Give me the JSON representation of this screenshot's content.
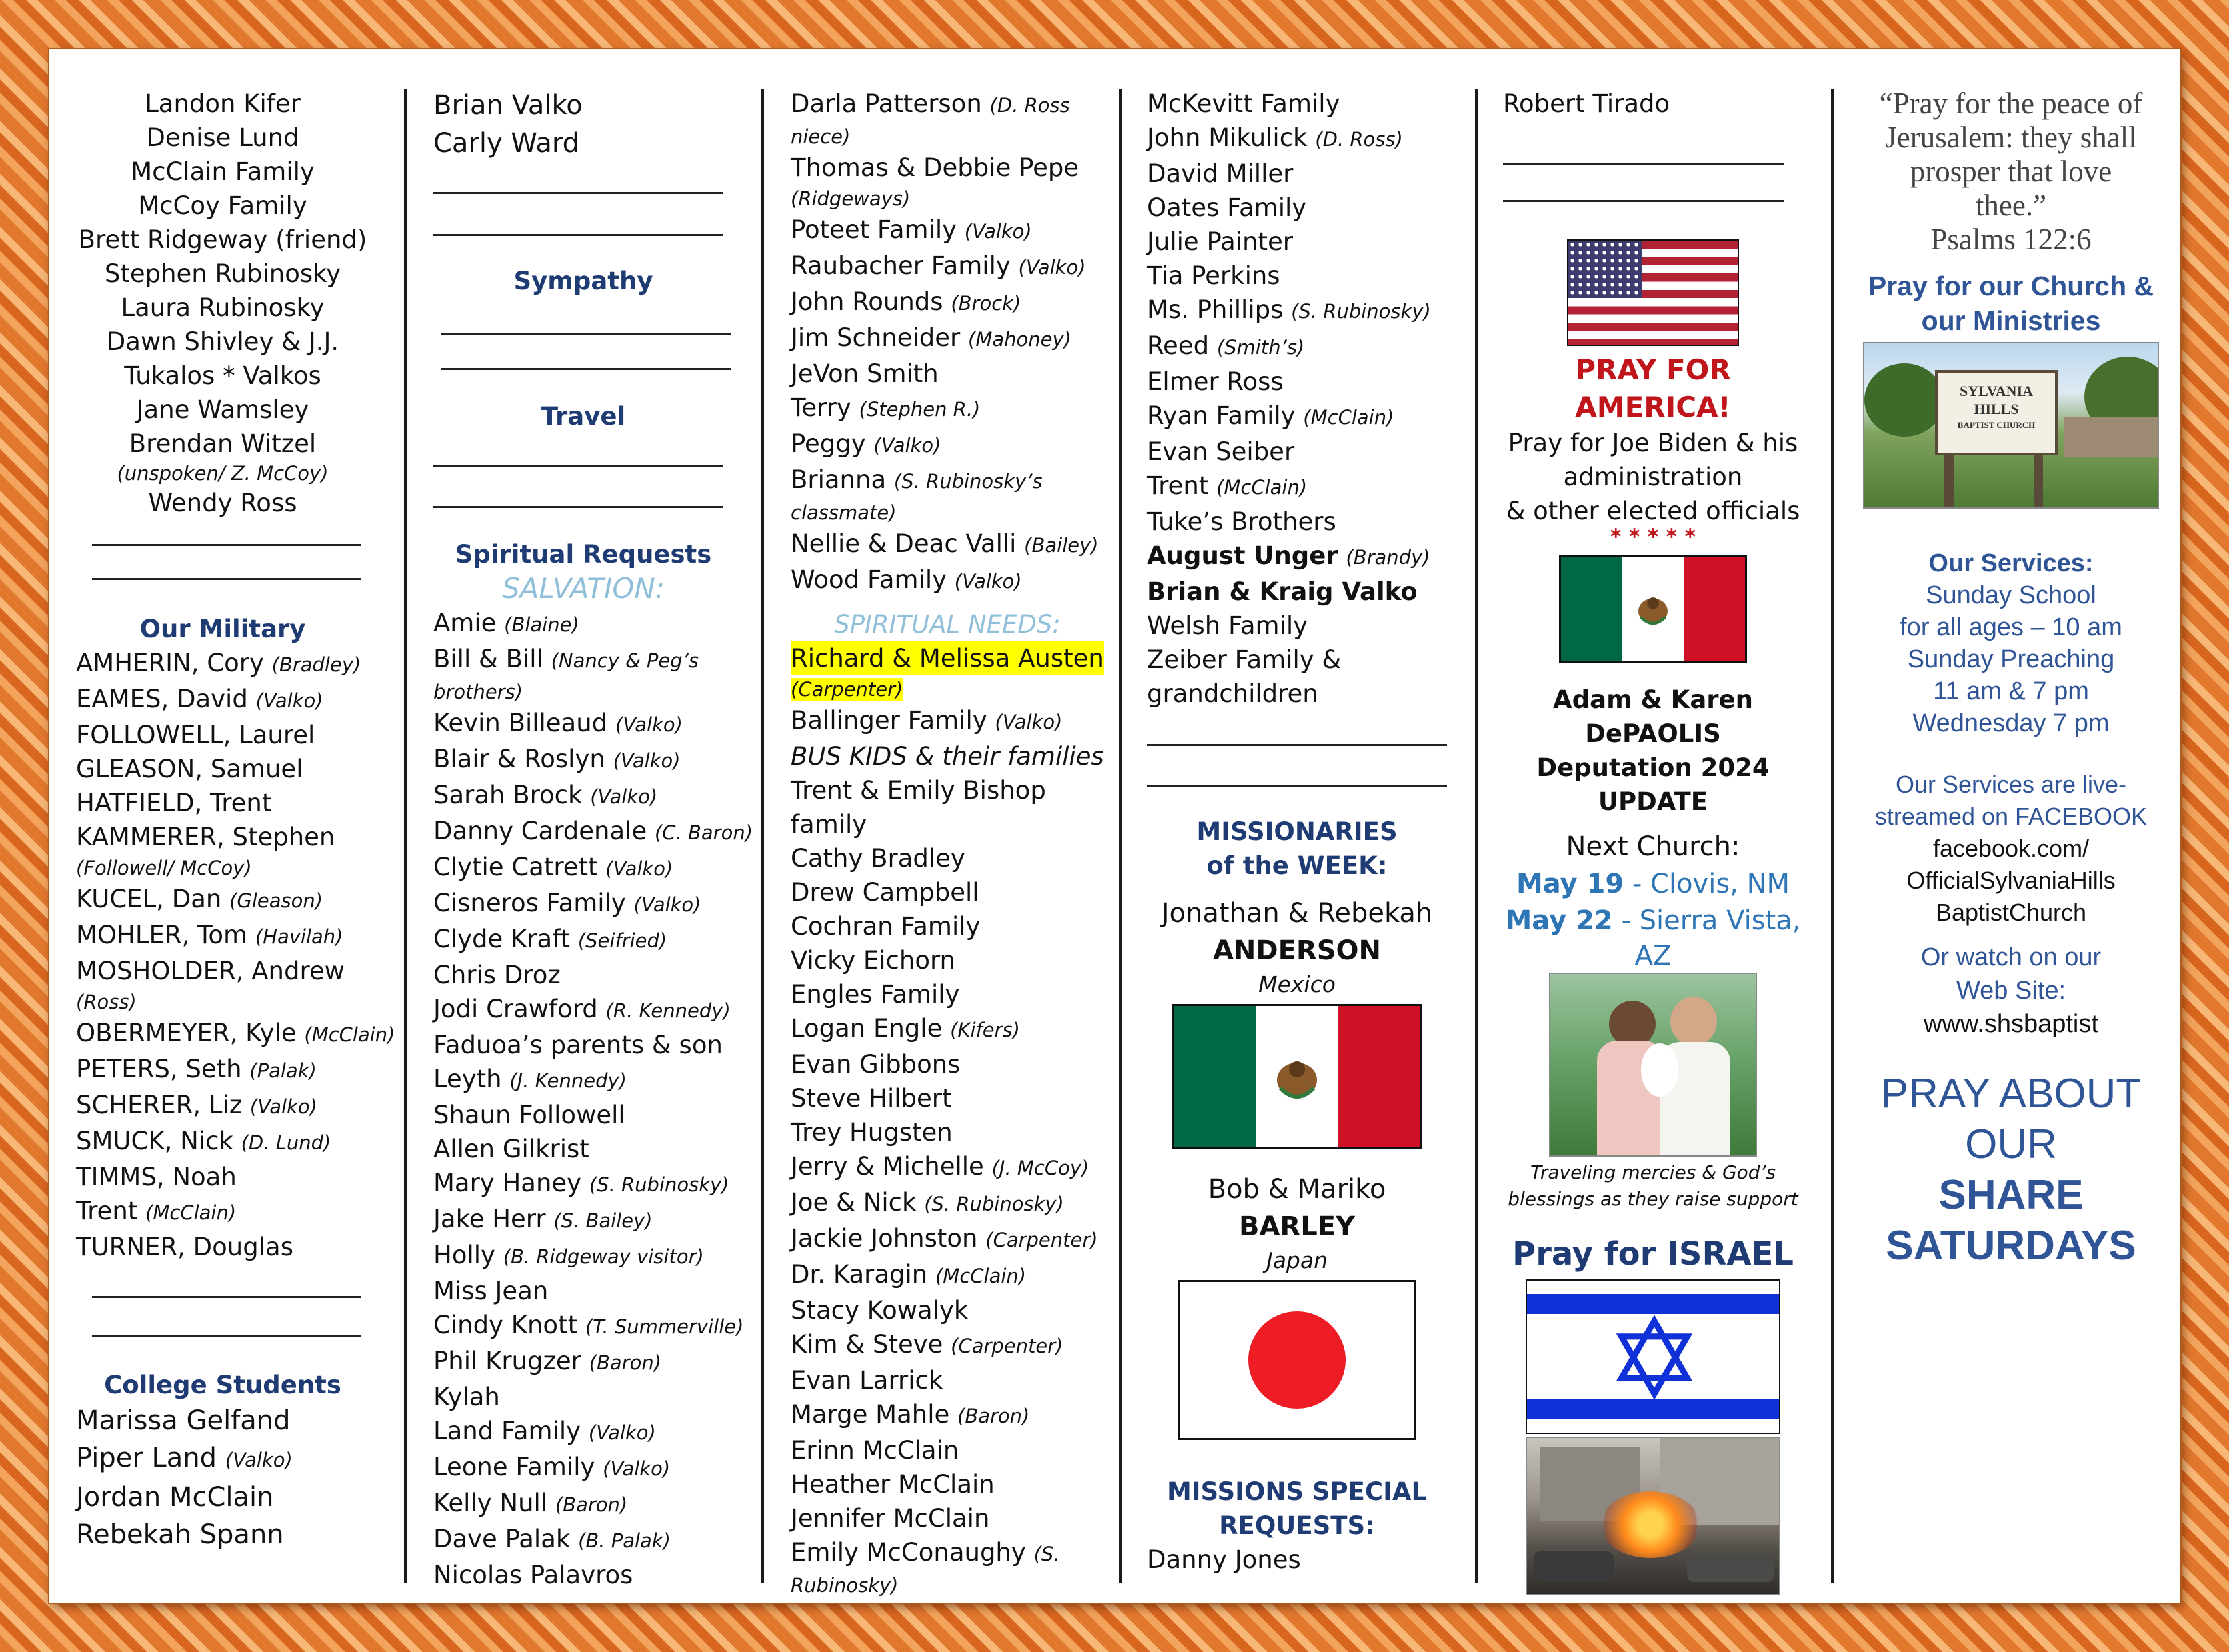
{
  "col1": {
    "names": [
      "Landon Kifer",
      "Denise Lund",
      "McClain Family",
      "McCoy Family",
      "Brett Ridgeway (friend)",
      "Stephen Rubinosky",
      "Laura Rubinosky",
      "Dawn Shivley & J.J.",
      "Tukalos * Valkos",
      "Jane Wamsley",
      "Brendan Witzel"
    ],
    "witzel_note": "(unspoken/ Z. McCoy)",
    "last": "Wendy Ross",
    "military_heading": "Our Military",
    "military": [
      {
        "name": "AMHERIN, Cory",
        "note": "(Bradley)"
      },
      {
        "name": "EAMES, David",
        "note": "(Valko)"
      },
      {
        "name": "FOLLOWELL, Laurel",
        "note": ""
      },
      {
        "name": "GLEASON, Samuel",
        "note": ""
      },
      {
        "name": "HATFIELD, Trent",
        "note": ""
      },
      {
        "name": "KAMMERER, Stephen",
        "note": ""
      }
    ],
    "kammerer_note": "(Followell/ McCoy)",
    "military2": [
      {
        "name": "KUCEL, Dan",
        "note": "(Gleason)"
      },
      {
        "name": "MOHLER, Tom",
        "note": "(Havilah)"
      },
      {
        "name": "MOSHOLDER, Andrew",
        "note": ""
      }
    ],
    "mosholder_note": "(Ross)",
    "military3": [
      {
        "name": "OBERMEYER, Kyle",
        "note": "(McClain)"
      },
      {
        "name": "PETERS, Seth",
        "note": "(Palak)"
      },
      {
        "name": "SCHERER, Liz",
        "note": "(Valko)"
      },
      {
        "name": "SMUCK, Nick",
        "note": "(D. Lund)"
      },
      {
        "name": "TIMMS, Noah",
        "note": ""
      },
      {
        "name": "Trent",
        "note": "(McClain)"
      },
      {
        "name": "TURNER, Douglas",
        "note": ""
      }
    ],
    "college_heading": "College Students",
    "college": [
      {
        "name": "Marissa Gelfand",
        "note": ""
      },
      {
        "name": "Piper Land",
        "note": "(Valko)"
      },
      {
        "name": "Jordan McClain",
        "note": ""
      },
      {
        "name": "Rebekah Spann",
        "note": ""
      }
    ]
  },
  "col2": {
    "top": [
      "Brian Valko",
      "Carly Ward"
    ],
    "sympathy_heading": "Sympathy",
    "travel_heading": "Travel",
    "spiritual_heading": "Spiritual Requests",
    "salvation_heading": "SALVATION:",
    "list": [
      {
        "name": "Amie",
        "note": "(Blaine)"
      },
      {
        "name": "Bill & Bill",
        "note": "(Nancy & Peg’s"
      }
    ],
    "bill_note2": "brothers)",
    "list2": [
      {
        "name": "Kevin Billeaud",
        "note": "(Valko)"
      },
      {
        "name": "Blair & Roslyn",
        "note": "(Valko)"
      },
      {
        "name": "Sarah Brock",
        "note": "(Valko)"
      },
      {
        "name": "Danny Cardenale",
        "note": "(C. Baron)"
      },
      {
        "name": "Clytie Catrett",
        "note": "(Valko)"
      },
      {
        "name": "Cisneros Family",
        "note": "(Valko)"
      },
      {
        "name": "Clyde Kraft",
        "note": "(Seifried)"
      },
      {
        "name": "Chris Droz",
        "note": ""
      },
      {
        "name": "Jodi Crawford",
        "note": "(R. Kennedy)"
      },
      {
        "name": "Faduoa’s parents & son",
        "note": ""
      },
      {
        "name": "Leyth",
        "note": "(J. Kennedy)"
      },
      {
        "name": "Shaun Followell",
        "note": ""
      },
      {
        "name": "Allen Gilkrist",
        "note": ""
      },
      {
        "name": "Mary Haney",
        "note": "(S. Rubinosky)"
      },
      {
        "name": "Jake Herr",
        "note": "(S. Bailey)"
      },
      {
        "name": "Holly",
        "note": "(B. Ridgeway visitor)"
      },
      {
        "name": "Miss Jean",
        "note": ""
      },
      {
        "name": "Cindy Knott",
        "note": "(T. Summerville)"
      },
      {
        "name": "Phil Krugzer",
        "note": "(Baron)"
      },
      {
        "name": "Kylah",
        "note": ""
      },
      {
        "name": "Land Family",
        "note": "(Valko)"
      },
      {
        "name": "Leone Family",
        "note": "(Valko)"
      },
      {
        "name": "Kelly Null",
        "note": "(Baron)"
      },
      {
        "name": "Dave Palak",
        "note": "(B. Palak)"
      },
      {
        "name": "Nicolas Palavros",
        "note": ""
      }
    ]
  },
  "col3": {
    "patterson": {
      "name": "Darla Patterson",
      "note": "(D. Ross",
      "note2": "niece)"
    },
    "pepe": {
      "name": "Thomas & Debbie Pepe",
      "note2": "(Ridgeways)"
    },
    "list": [
      {
        "name": "Poteet Family",
        "note": "(Valko)"
      },
      {
        "name": "Raubacher Family",
        "note": "(Valko)"
      },
      {
        "name": "John Rounds",
        "note": "(Brock)"
      },
      {
        "name": "Jim Schneider",
        "note": "(Mahoney)"
      },
      {
        "name": "JeVon Smith",
        "note": ""
      },
      {
        "name": "Terry",
        "note": "(Stephen R.)"
      },
      {
        "name": "Peggy",
        "note": "(Valko)"
      }
    ],
    "brianna": {
      "name": "Brianna",
      "note": "(S. Rubinosky’s",
      "note2": "classmate)"
    },
    "list2": [
      {
        "name": "Nellie & Deac Valli",
        "note": "(Bailey)"
      },
      {
        "name": "Wood Family",
        "note": "(Valko)"
      }
    ],
    "spiritual_needs": "SPIRITUAL NEEDS:",
    "austen": {
      "name": "Richard & Melissa Austen",
      "note2": "(Carpenter)"
    },
    "ballinger": {
      "name": "Ballinger Family",
      "note": "(Valko)"
    },
    "bus": "BUS KIDS & their families",
    "list3": [
      "Trent & Emily Bishop",
      "family",
      "Cathy Bradley",
      "Drew Campbell",
      "Cochran Family",
      "Vicky Eichorn",
      "Engles Family"
    ],
    "list4": [
      {
        "name": "Logan Engle",
        "note": "(Kifers)"
      },
      {
        "name": "Evan Gibbons",
        "note": ""
      },
      {
        "name": "Steve Hilbert",
        "note": ""
      },
      {
        "name": "Trey Hugsten",
        "note": ""
      },
      {
        "name": "Jerry & Michelle",
        "note": "(J. McCoy)"
      },
      {
        "name": "Joe & Nick",
        "note": "(S. Rubinosky)"
      },
      {
        "name": "Jackie Johnston",
        "note": "(Carpenter)"
      },
      {
        "name": "Dr. Karagin",
        "note": "(McClain)"
      },
      {
        "name": "Stacy Kowalyk",
        "note": ""
      },
      {
        "name": "Kim & Steve",
        "note": "(Carpenter)"
      },
      {
        "name": "Evan Larrick",
        "note": ""
      },
      {
        "name": "Marge Mahle",
        "note": "(Baron)"
      },
      {
        "name": "Erinn McClain",
        "note": ""
      },
      {
        "name": "Heather McClain",
        "note": ""
      },
      {
        "name": "Jennifer McClain",
        "note": ""
      }
    ],
    "mcconaughy": {
      "name": "Emily McConaughy",
      "note": "(S.",
      "note2": "Rubinosky)"
    }
  },
  "col4": {
    "list": [
      {
        "name": "McKevitt Family",
        "note": "",
        "bold": false
      },
      {
        "name": "John Mikulick",
        "note": "(D. Ross)",
        "bold": false
      },
      {
        "name": "David Miller",
        "note": "",
        "bold": false
      },
      {
        "name": "Oates Family",
        "note": "",
        "bold": false
      },
      {
        "name": "Julie Painter",
        "note": "",
        "bold": false
      },
      {
        "name": "Tia Perkins",
        "note": "",
        "bold": false
      },
      {
        "name": "Ms. Phillips",
        "note": "(S. Rubinosky)",
        "bold": false
      },
      {
        "name": "Reed",
        "note": "(Smith’s)",
        "bold": false
      },
      {
        "name": "Elmer Ross",
        "note": "",
        "bold": false
      },
      {
        "name": "Ryan Family",
        "note": "(McClain)",
        "bold": false
      },
      {
        "name": "Evan Seiber",
        "note": "",
        "bold": false
      },
      {
        "name": "Trent",
        "note": "(McClain)",
        "bold": false
      },
      {
        "name": "Tuke’s Brothers",
        "note": "",
        "bold": false
      },
      {
        "name": "August Unger",
        "note": "(Brandy)",
        "bold": true
      },
      {
        "name": "Brian & Kraig Valko",
        "note": "",
        "bold": true
      },
      {
        "name": "Welsh Family",
        "note": "",
        "bold": false
      },
      {
        "name": "Zeiber Family &",
        "note": "",
        "bold": false
      },
      {
        "name": "grandchildren",
        "note": "",
        "bold": false
      }
    ],
    "missionaries_heading1": "MISSIONARIES",
    "missionaries_heading2": "of the WEEK:",
    "m1_names": "Jonathan & Rebekah",
    "m1_surname": "ANDERSON",
    "m1_country": "Mexico",
    "m2_names": "Bob & Mariko",
    "m2_surname": "BARLEY",
    "m2_country": "Japan",
    "special_heading1": "MISSIONS SPECIAL",
    "special_heading2": "REQUESTS:",
    "special_name": "Danny Jones"
  },
  "col5": {
    "top": "Robert Tirado",
    "pray_america": "PRAY FOR AMERICA!",
    "america_lines": [
      "Pray for Joe Biden & his",
      "administration",
      "& other elected officials"
    ],
    "stars": "* * * * *",
    "depaolis1": "Adam & Karen DePAOLIS",
    "depaolis2": "Deputation 2024 UPDATE",
    "next_church": "Next Church:",
    "date1": "May 19",
    "place1": " - Clovis, NM",
    "date2": "May 22",
    "place2": " - Sierra Vista,",
    "place2b": "AZ",
    "caption1": "Traveling mercies & God’s",
    "caption2": "blessings as they raise support",
    "pray_israel": "Pray for ISRAEL"
  },
  "col6": {
    "verse": [
      "“Pray for the peace of",
      "Jerusalem: they shall",
      "prosper that love",
      "thee.”",
      "Psalms 122:6"
    ],
    "church_heading": [
      "Pray for our Church &",
      "our Ministries"
    ],
    "sign": [
      "SYLVANIA",
      "HILLS",
      "BAPTIST CHURCH"
    ],
    "services_heading": "Our Services:",
    "services": [
      "Sunday School",
      "for all ages – 10 am",
      "Sunday Preaching",
      "11 am & 7 pm",
      "Wednesday 7 pm"
    ],
    "live": [
      "Our Services are live-",
      "streamed on FACEBOOK"
    ],
    "fb": [
      "facebook.com/",
      "OfficialSylvaniaHills",
      "BaptistChurch"
    ],
    "watch": [
      "Or watch on our",
      "Web Site:"
    ],
    "site": "www.shsbaptist",
    "pray_about": [
      "PRAY ABOUT",
      "OUR"
    ],
    "share": [
      "SHARE",
      "SATURDAYS"
    ]
  },
  "colors": {
    "heading": "#1f3b73",
    "salvation": "#8fbfd9",
    "red": "#c0151b",
    "highlight": "#ffff00",
    "link_blue": "#2e75b6",
    "big_blue": "#2f5597"
  }
}
